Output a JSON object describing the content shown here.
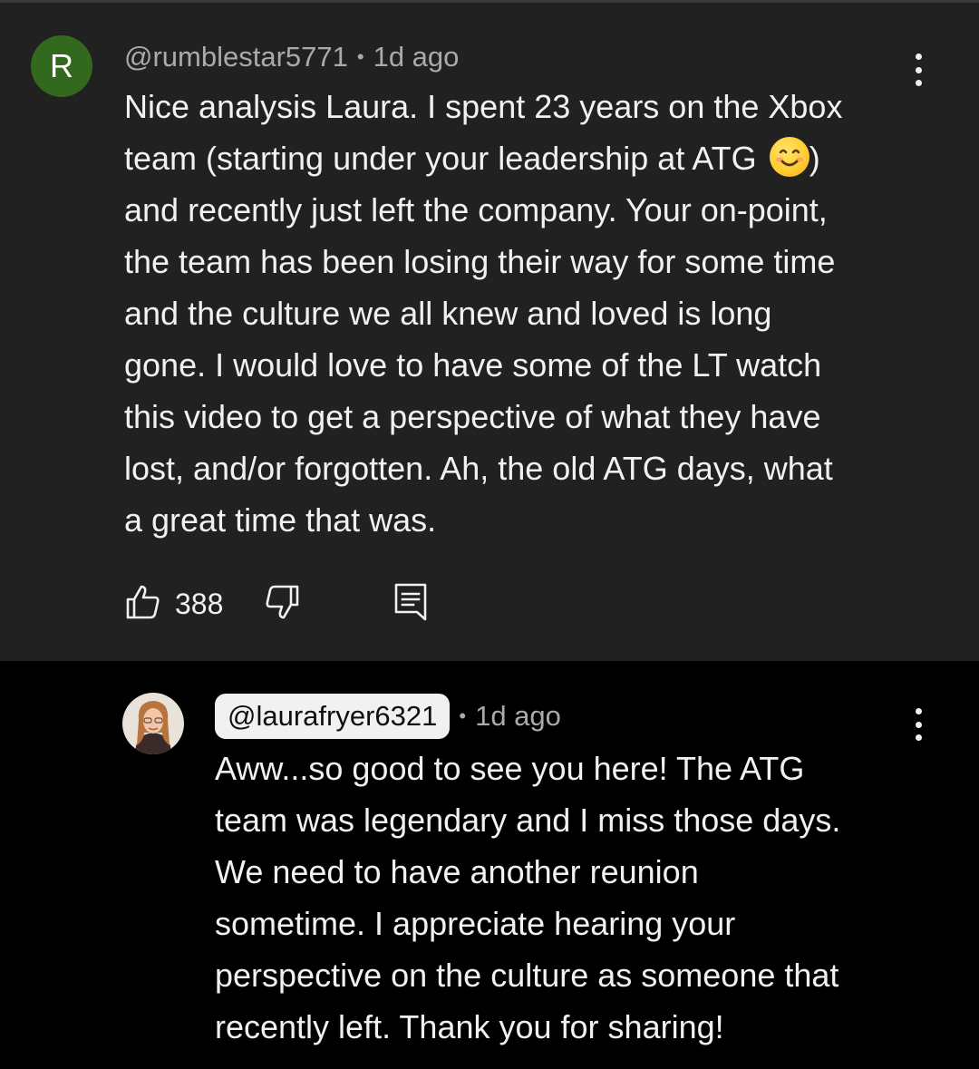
{
  "comment": {
    "avatar_letter": "R",
    "avatar_color": "#33691e",
    "handle": "@rumblestar5771",
    "separator": "•",
    "time": "1d ago",
    "lines": [
      "Nice analysis Laura. I spent 23 years on the Xbox",
      "team (starting under your leadership at ATG",
      ")",
      "and recently just left the company. Your on-point,",
      "the team has been losing their way for some time",
      "and the culture we all knew and loved is long",
      "gone.  I would love to have some of the LT watch",
      "this video to get a perspective of what they have",
      "lost, and/or forgotten. Ah, the old ATG days, what",
      "a great time that was."
    ],
    "emoji": "smiling-face-emoji",
    "like_count": "388",
    "icons": [
      "thumbs-up-icon",
      "thumbs-down-icon",
      "reply-comment-icon",
      "more-vert-icon"
    ]
  },
  "reply": {
    "handle": "@laurafryer6321",
    "separator": "•",
    "time": "1d ago",
    "lines": [
      "Aww...so good to see you here! The ATG",
      "team was legendary and I miss those days.",
      "We need to have another reunion",
      "sometime. I appreciate hearing your",
      "perspective on the culture as someone that",
      "recently left. Thank you for sharing!"
    ],
    "icons": [
      "more-vert-icon"
    ]
  },
  "colors": {
    "top_background": "#212121",
    "reply_background": "#000000",
    "text": "#f1f1f1",
    "meta_text": "#aaaaaa",
    "handle_chip": "#f1f1f1"
  }
}
